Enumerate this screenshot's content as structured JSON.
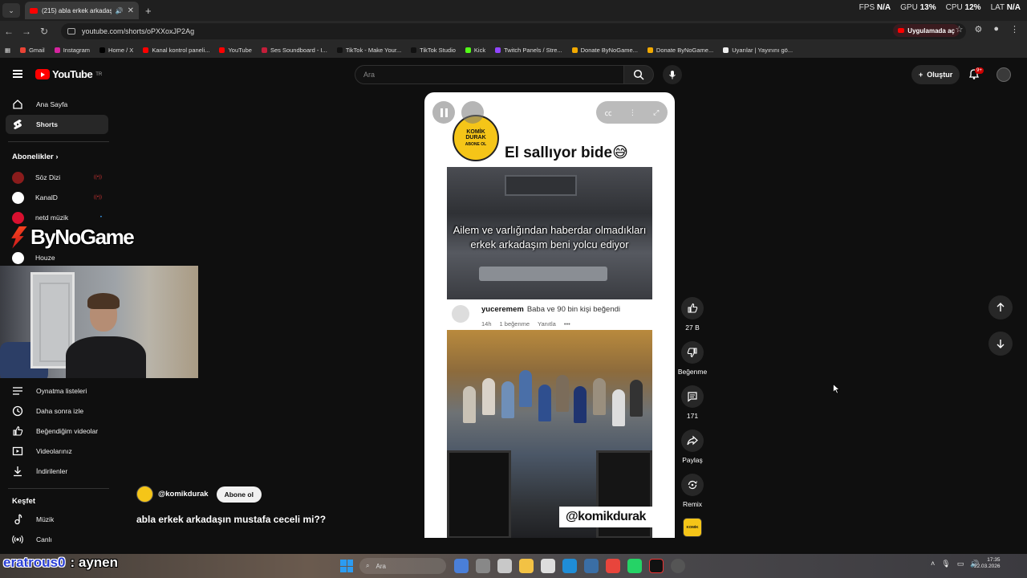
{
  "browser": {
    "tab_title": "(215) abla erkek arkadaşın m",
    "url": "youtube.com/shorts/oPXXoxJP2Ag",
    "open_in_app": "Uygulamada aç",
    "bookmarks": [
      {
        "label": "Gmail",
        "color": "#ea4335"
      },
      {
        "label": "Instagram",
        "color": "#d6249f"
      },
      {
        "label": "Home / X",
        "color": "#000000"
      },
      {
        "label": "Kanal kontrol paneli...",
        "color": "#ff0000"
      },
      {
        "label": "YouTube",
        "color": "#ff0000"
      },
      {
        "label": "Ses Soundboard - I...",
        "color": "#c41e3a"
      },
      {
        "label": "TikTok - Make Your...",
        "color": "#111111"
      },
      {
        "label": "TikTok Studio",
        "color": "#111111"
      },
      {
        "label": "Kick",
        "color": "#53fc18"
      },
      {
        "label": "Twitch Panels / Stre...",
        "color": "#9146ff"
      },
      {
        "label": "Donate ByNoGame...",
        "color": "#f2a900"
      },
      {
        "label": "Donate ByNoGame...",
        "color": "#f2a900"
      },
      {
        "label": "Uyarılar | Yayınını gö...",
        "color": "#eeeeee"
      }
    ]
  },
  "perf_overlay": {
    "fps_label": "FPS",
    "fps_value": "N/A",
    "gpu_label": "GPU",
    "gpu_value": "13",
    "cpu_label": "CPU",
    "cpu_value": "12",
    "lat_label": "LAT",
    "lat_value": "N/A"
  },
  "header": {
    "logo_text": "YouTube",
    "logo_region": "TR",
    "search_placeholder": "Ara",
    "create_label": "Oluştur",
    "notification_count": "9+"
  },
  "sidebar": {
    "home": "Ana Sayfa",
    "shorts": "Shorts",
    "subscriptions_heading": "Abonelikler",
    "subscriptions": [
      {
        "name": "Söz Dizi",
        "color": "#8a1c1c"
      },
      {
        "name": "KanalD",
        "color": "#ffffff"
      },
      {
        "name": "netd müzik",
        "color": "#d8102f"
      },
      {
        "name": "Houze",
        "color": "#ffffff"
      }
    ],
    "library": [
      {
        "label": "Oynatma listeleri"
      },
      {
        "label": "Daha sonra izle"
      },
      {
        "label": "Beğendiğim videolar"
      },
      {
        "label": "Videolarınız"
      },
      {
        "label": "İndirilenler"
      }
    ],
    "explore_heading": "Keşfet",
    "explore": [
      {
        "label": "Müzik"
      },
      {
        "label": "Canlı"
      }
    ]
  },
  "stream_overlay": {
    "watermark": "ByNoGame",
    "chat_user": "eratrous0",
    "chat_separator": ":",
    "chat_message": "aynen"
  },
  "short": {
    "channel_logo_line1": "KOMİK",
    "channel_logo_line2": "DURAK",
    "channel_logo_sub": "ABONE OL",
    "caption": "El sallıyor bide😅",
    "frame_caption": "Ailem ve varlığından haberdar olmadıkları erkek arkadaşım beni yolcu ediyor",
    "comment_user": "yuceremem",
    "comment_text": "Baba ve 90 bin kişi beğendi",
    "comment_time": "14h",
    "comment_likes": "1 beğenme",
    "comment_reply": "Yanıtla",
    "comment_more": "•••",
    "handle": "@komikdurak"
  },
  "actions": {
    "like_count": "27 B",
    "dislike_label": "Beğenme",
    "comment_count": "171",
    "share_label": "Paylaş",
    "remix_label": "Remix"
  },
  "channel": {
    "handle": "@komikdurak",
    "subscribe": "Abone ol",
    "video_title": "abla erkek arkadaşın mustafa ceceli mi??"
  },
  "taskbar": {
    "search_label": "Ara",
    "time": "17:35",
    "date": "22.03.2026"
  }
}
